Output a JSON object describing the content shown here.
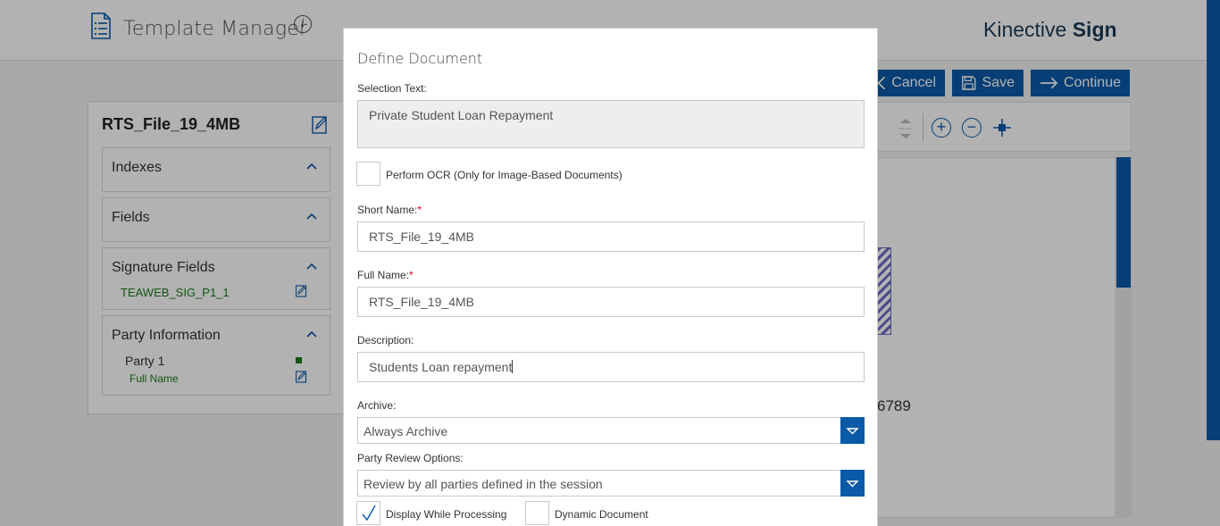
{
  "header": {
    "app_title": "Template Manager",
    "info_glyph": "i",
    "brand_light": "Kinective ",
    "brand_bold": "Sign"
  },
  "actions": {
    "cancel_label": "Cancel",
    "save_label": "Save",
    "continue_label": "Continue"
  },
  "document": {
    "title": "RTS_File_19_4MB",
    "viewer_text_fragment": "6789"
  },
  "sidebar": {
    "sections": [
      {
        "title": "Indexes"
      },
      {
        "title": "Fields"
      },
      {
        "title": "Signature Fields",
        "items": [
          "TEAWEB_SIG_P1_1"
        ]
      },
      {
        "title": "Party Information",
        "party": "Party 1",
        "field": "Full Name"
      }
    ]
  },
  "modal": {
    "title": "Define Document",
    "selection_text_label": "Selection Text:",
    "selection_text_value": "Private Student Loan Repayment",
    "ocr_label": "Perform OCR (Only for Image-Based Documents)",
    "ocr_checked": false,
    "short_name_label": "Short Name:",
    "short_name_value": "RTS_File_19_4MB",
    "full_name_label": "Full Name:",
    "full_name_value": "RTS_File_19_4MB",
    "required_mark": "*",
    "description_label": "Description:",
    "description_value": "Students Loan repayment",
    "archive_label": "Archive:",
    "archive_value": "Always Archive",
    "party_review_label": "Party Review Options:",
    "party_review_value": "Review by all parties defined in the session",
    "display_while_processing_label": "Display While Processing",
    "display_while_processing_checked": true,
    "dynamic_document_label": "Dynamic Document",
    "dynamic_document_checked": false
  },
  "colors": {
    "accent": "#0a5aa8",
    "field_item_green": "#1c7a1c",
    "required_red": "#d0021b"
  }
}
